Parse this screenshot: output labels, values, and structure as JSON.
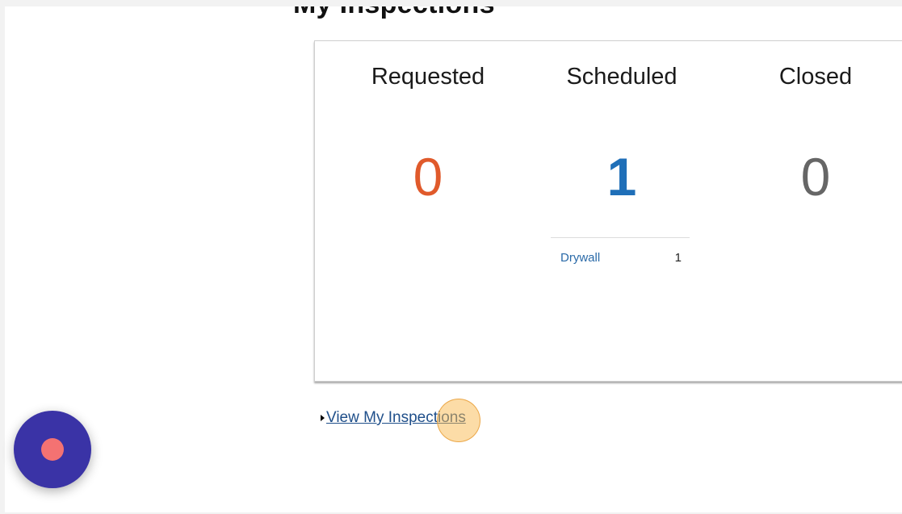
{
  "page": {
    "title": "My Inspections"
  },
  "stats": {
    "requested": {
      "label": "Requested",
      "count": "0",
      "color": "#e05a2b"
    },
    "scheduled": {
      "label": "Scheduled",
      "count": "1",
      "color": "#1f6fb8",
      "breakdown": [
        {
          "label": "Drywall",
          "value": "1"
        }
      ]
    },
    "closed": {
      "label": "Closed",
      "count": "0",
      "color": "#666666"
    }
  },
  "link": {
    "view_label": "View My Inspections",
    "icon": "caret-right-icon"
  },
  "fab": {
    "icon": "record-icon",
    "color": "#3a33a6",
    "dot_color": "#f47272"
  }
}
